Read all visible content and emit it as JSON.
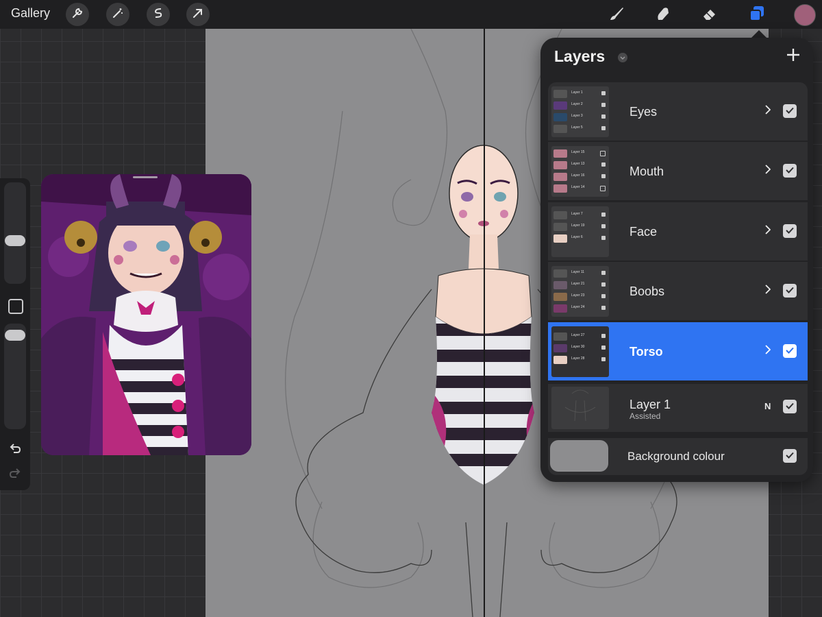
{
  "toolbar": {
    "gallery_label": "Gallery",
    "left_tools": [
      "wrench-icon",
      "magic-wand-icon",
      "selection-icon",
      "transform-arrow-icon"
    ],
    "right_tools": [
      "brush-icon",
      "smudge-icon",
      "eraser-icon",
      "layers-icon"
    ],
    "current_color": "#a0607a",
    "active_tool_color": "#2f74f2"
  },
  "layers_panel": {
    "title": "Layers",
    "layers": [
      {
        "name": "Eyes",
        "sub": "",
        "type": "group",
        "visible": true,
        "selected": false,
        "thumb_rows": [
          "Layer 1",
          "Layer 2",
          "Layer 3",
          "Layer 5"
        ]
      },
      {
        "name": "Mouth",
        "sub": "",
        "type": "group",
        "visible": true,
        "selected": false,
        "thumb_rows": [
          "Layer 15",
          "Layer 13",
          "Layer 16",
          "Layer 14"
        ]
      },
      {
        "name": "Face",
        "sub": "",
        "type": "group",
        "visible": true,
        "selected": false,
        "thumb_rows": [
          "Layer 7",
          "Layer 19",
          "Layer 6"
        ]
      },
      {
        "name": "Boobs",
        "sub": "",
        "type": "group",
        "visible": true,
        "selected": false,
        "thumb_rows": [
          "Layer 11",
          "Layer 21",
          "Layer 23",
          "Layer 24"
        ]
      },
      {
        "name": "Torso",
        "sub": "",
        "type": "group",
        "visible": true,
        "selected": true,
        "thumb_rows": [
          "Layer 27",
          "Layer 30",
          "Layer 28"
        ]
      },
      {
        "name": "Layer 1",
        "sub": "Assisted",
        "type": "layer",
        "blend": "N",
        "visible": true,
        "selected": false,
        "thumb_rows": []
      }
    ],
    "background": {
      "name": "Background colour",
      "color": "#8d8d8f",
      "visible": true
    }
  }
}
